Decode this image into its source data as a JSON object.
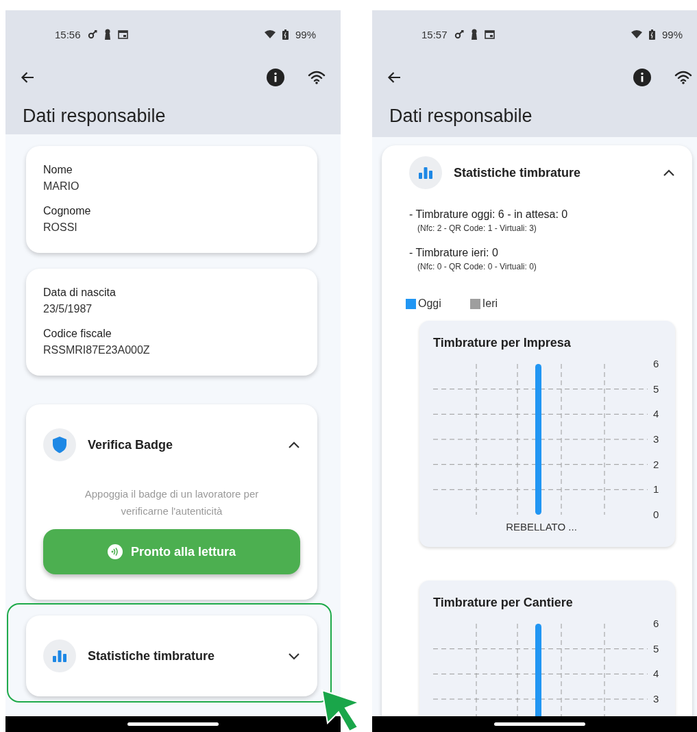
{
  "screens": [
    {
      "status_bar": {
        "time": "15:56",
        "battery": "99%"
      },
      "title": "Dati responsabile",
      "cards": [
        {
          "kind": "info",
          "fields": [
            {
              "label": "Nome",
              "value": "MARIO"
            },
            {
              "label": "Cognome",
              "value": "ROSSI"
            }
          ]
        },
        {
          "kind": "info",
          "fields": [
            {
              "label": "Data di nascita",
              "value": "23/5/1987"
            },
            {
              "label": "Codice fiscale",
              "value": "RSSMRI87E23A000Z"
            }
          ]
        },
        {
          "kind": "badge",
          "title": "Verifica Badge",
          "expanded": true,
          "description": "Appoggia il badge di un lavoratore per verificarne l'autenticità",
          "button": "Pronto alla lettura"
        },
        {
          "kind": "stats",
          "title": "Statistiche timbrature",
          "expanded": false
        }
      ]
    },
    {
      "status_bar": {
        "time": "15:57",
        "battery": "99%"
      },
      "title": "Dati responsabile",
      "cards": [
        {
          "kind": "stats",
          "title": "Statistiche timbrature",
          "expanded": true,
          "stats": [
            {
              "line": "- Timbrature oggi: 6 - in attesa: 0",
              "detail": "(Nfc: 2 - QR Code: 1 - Virtuali: 3)"
            },
            {
              "line": "- Timbrature ieri: 0",
              "detail": "(Nfc: 0 - QR Code: 0 - Virtuali: 0)"
            }
          ],
          "legend": [
            {
              "label": "Oggi",
              "color": "#2196f3"
            },
            {
              "label": "Ieri",
              "color": "#9e9e9e"
            }
          ],
          "charts": [
            {
              "chart_data": {
                "type": "bar",
                "title": "Timbrature per Impresa",
                "categories": [
                  "REBELLATO ..."
                ],
                "series": [
                  {
                    "color": "#2196f3",
                    "values": [
                      6
                    ]
                  },
                  {
                    "color": "#9e9e9e",
                    "values": [
                      0
                    ]
                  }
                ],
                "ylim": [
                  0,
                  6
                ],
                "yticks": [
                  0,
                  1,
                  2,
                  3,
                  4,
                  5,
                  6
                ],
                "grid": true
              }
            },
            {
              "chart_data": {
                "type": "bar",
                "title": "Timbrature per Cantiere",
                "series": [
                  {
                    "color": "#2196f3",
                    "values": [
                      6
                    ]
                  },
                  {
                    "color": "#9e9e9e",
                    "values": [
                      0
                    ]
                  }
                ],
                "ylim": [
                  0,
                  6
                ],
                "yticks": [
                  3,
                  4,
                  5,
                  6
                ],
                "grid": true
              }
            }
          ]
        }
      ]
    }
  ]
}
